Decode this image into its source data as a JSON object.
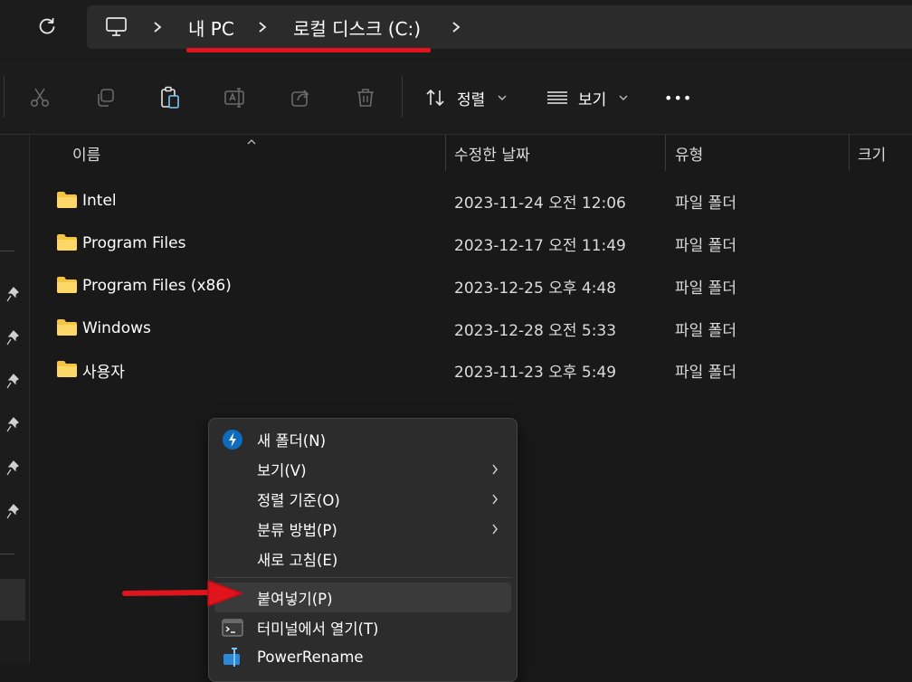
{
  "address": {
    "crumbs": [
      "내 PC",
      "로컬 디스크 (C:)"
    ],
    "icons": [
      "refresh-icon",
      "computer-icon",
      "chevron-right-icon"
    ]
  },
  "toolbar": {
    "buttons": [
      "cut",
      "copy",
      "paste",
      "rename",
      "share",
      "delete"
    ],
    "sort_label": "정렬",
    "view_label": "보기",
    "more_label": "•••"
  },
  "columns": {
    "name": "이름",
    "date": "수정한 날짜",
    "type": "유형",
    "size": "크기"
  },
  "files": [
    {
      "name": "Intel",
      "date": "2023-11-24 오전 12:06",
      "type": "파일 폴더"
    },
    {
      "name": "Program Files",
      "date": "2023-12-17 오전 11:49",
      "type": "파일 폴더"
    },
    {
      "name": "Program Files (x86)",
      "date": "2023-12-25 오후 4:48",
      "type": "파일 폴더"
    },
    {
      "name": "Windows",
      "date": "2023-12-28 오전 5:33",
      "type": "파일 폴더"
    },
    {
      "name": "사용자",
      "date": "2023-11-23 오후 5:49",
      "type": "파일 폴더"
    }
  ],
  "context_menu": {
    "items": [
      {
        "label": "새 폴더(N)"
      },
      {
        "label": "보기(V)"
      },
      {
        "label": "정렬 기준(O)"
      },
      {
        "label": "분류 방법(P)"
      },
      {
        "label": "새로 고침(E)"
      },
      {
        "label": "붙여넣기(P)"
      },
      {
        "label": "터미널에서 열기(T)"
      },
      {
        "label": "PowerRename"
      }
    ]
  },
  "colors": {
    "background": "#191919",
    "highlight_red": "#e0141c",
    "folder_yellow": "#f5c542",
    "accent_blue": "#0f6cbd"
  }
}
